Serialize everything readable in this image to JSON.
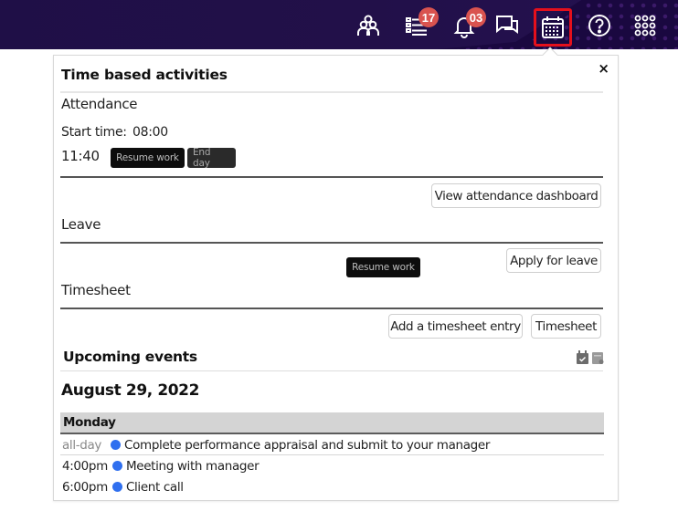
{
  "topbar": {
    "icons": [
      {
        "name": "team-icon",
        "badge": null
      },
      {
        "name": "tasks-list-icon",
        "badge": "17"
      },
      {
        "name": "notifications-bell-icon",
        "badge": "03"
      },
      {
        "name": "chat-icon",
        "badge": null
      },
      {
        "name": "calendar-icon",
        "badge": null,
        "active": true
      },
      {
        "name": "help-icon",
        "badge": null
      },
      {
        "name": "apps-grid-icon",
        "badge": null
      }
    ],
    "badges": {
      "tasks": "17",
      "notifications": "03"
    },
    "active_color": "#e5101c",
    "background_color": "#1f0f47"
  },
  "panel": {
    "title": "Time based activities",
    "close_label": "×",
    "attendance": {
      "label": "Attendance",
      "start_time_label": "Start time:",
      "start_time": "08:00",
      "current_time": "11:40",
      "resume_button": "Resume work",
      "end_day_button": "End day",
      "dashboard_button": "View attendance dashboard"
    },
    "leave": {
      "label": "Leave",
      "tooltip": "Resume work",
      "apply_button": "Apply for leave"
    },
    "timesheet": {
      "label": "Timesheet",
      "add_entry_button": "Add a timesheet entry",
      "timesheet_button": "Timesheet"
    },
    "upcoming": {
      "title": "Upcoming events",
      "date": "August 29, 2022",
      "day": "Monday",
      "event_color": "#2f6fef",
      "events": [
        {
          "time": "all-day",
          "title": "Complete performance appraisal and submit to your manager"
        },
        {
          "time": "4:00pm",
          "title": "Meeting with manager"
        },
        {
          "time": "6:00pm",
          "title": "Client call"
        }
      ]
    }
  }
}
